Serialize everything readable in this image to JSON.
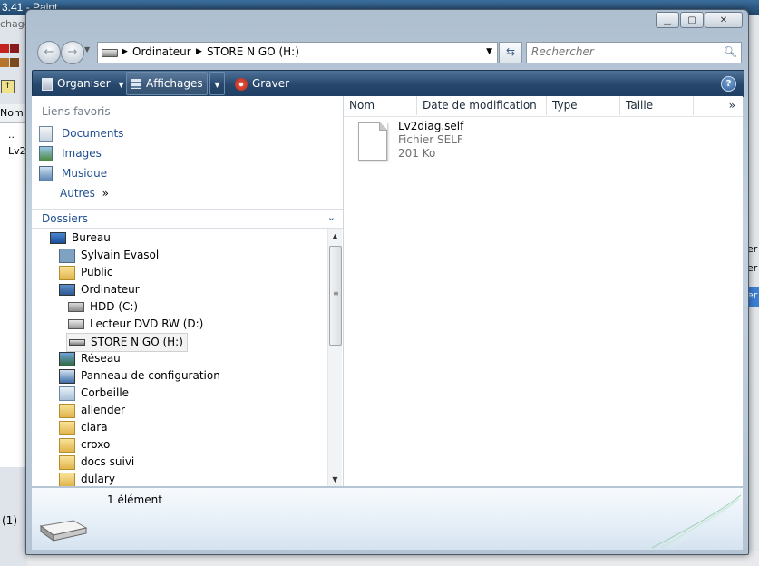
{
  "background_window": {
    "title": "3.41 - Paint",
    "left_column_header": "Nom",
    "left_items": [
      "..",
      "Lv2"
    ],
    "left_label_top": "chage",
    "bottom_text": "(1)",
    "right_fragments": [
      "er",
      "er",
      "er"
    ]
  },
  "window": {
    "caption_buttons": [
      "minimize",
      "maximize",
      "close"
    ],
    "address_crumbs": [
      "Ordinateur",
      "STORE N GO (H:)"
    ],
    "search_placeholder": "Rechercher",
    "toolbar": {
      "organize": "Organiser",
      "views": "Affichages",
      "burn": "Graver"
    },
    "favorites_header": "Liens favoris",
    "favorites": [
      {
        "label": "Documents",
        "icon": "documents-icon"
      },
      {
        "label": "Images",
        "icon": "pictures-icon"
      },
      {
        "label": "Musique",
        "icon": "music-icon"
      },
      {
        "label": "Autres",
        "icon": "more-chevron-icon"
      }
    ],
    "folders_header": "Dossiers",
    "tree": [
      {
        "label": "Bureau",
        "icon": "desktop-icon"
      },
      {
        "label": "Sylvain Evasol",
        "icon": "user-folder-icon"
      },
      {
        "label": "Public",
        "icon": "folder-icon"
      },
      {
        "label": "Ordinateur",
        "icon": "computer-icon"
      },
      {
        "label": "HDD (C:)",
        "icon": "hard-drive-icon"
      },
      {
        "label": "Lecteur DVD RW (D:)",
        "icon": "dvd-drive-icon"
      },
      {
        "label": "STORE N GO (H:)",
        "icon": "usb-drive-icon",
        "selected": true
      },
      {
        "label": "Réseau",
        "icon": "network-icon"
      },
      {
        "label": "Panneau de configuration",
        "icon": "control-panel-icon"
      },
      {
        "label": "Corbeille",
        "icon": "recycle-bin-icon"
      },
      {
        "label": "allender",
        "icon": "folder-icon"
      },
      {
        "label": "clara",
        "icon": "folder-icon"
      },
      {
        "label": "croxo",
        "icon": "folder-icon"
      },
      {
        "label": "docs suivi",
        "icon": "folder-icon"
      },
      {
        "label": "dulary",
        "icon": "folder-icon"
      }
    ],
    "columns": [
      "Nom",
      "Date de modification",
      "Type",
      "Taille"
    ],
    "columns_more": "»",
    "files": [
      {
        "name": "Lv2diag.self",
        "type": "Fichier SELF",
        "size": "201 Ko"
      }
    ],
    "details": {
      "count": "1 élément"
    },
    "colors": {
      "toolbar": "#27476c",
      "link": "#1f4e91",
      "selection": "#f3f3f3"
    }
  }
}
